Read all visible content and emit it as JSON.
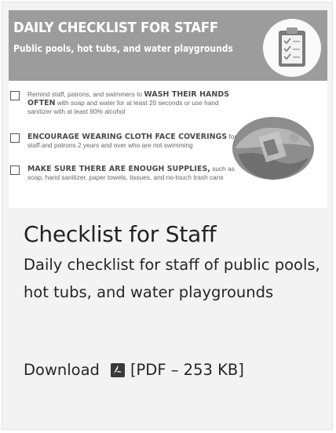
{
  "thumbnail": {
    "banner_title": "DAILY CHECKLIST FOR STAFF",
    "banner_subtitle": "Public pools, hot tubs, and water playgrounds",
    "items": [
      {
        "pre": "Remind staff, patrons, and swimmers to ",
        "bold": "WASH THEIR HANDS OFTEN",
        "post": " with soap and water for at least 20 seconds or use hand sanitizer with at least 60% alcohol"
      },
      {
        "pre": "",
        "bold": "ENCOURAGE WEARING CLOTH FACE COVERINGS",
        "post": " for staff and patrons 2 years and over who are not swimming"
      },
      {
        "pre": "",
        "bold": "MAKE SURE THERE ARE ENOUGH SUPPLIES,",
        "post": " such as soap, hand sanitizer, paper towels, tissues, and no-touch trash cans"
      }
    ]
  },
  "title": "Checklist for Staff",
  "description": "Daily checklist for staff of public pools, hot tubs, and water playgrounds",
  "download": {
    "label": "Download",
    "file": "[PDF – 253 KB]"
  },
  "icons": {
    "clipboard": "clipboard-icon",
    "globe": "pool-globe-icon",
    "pdf": "pdf-icon"
  }
}
